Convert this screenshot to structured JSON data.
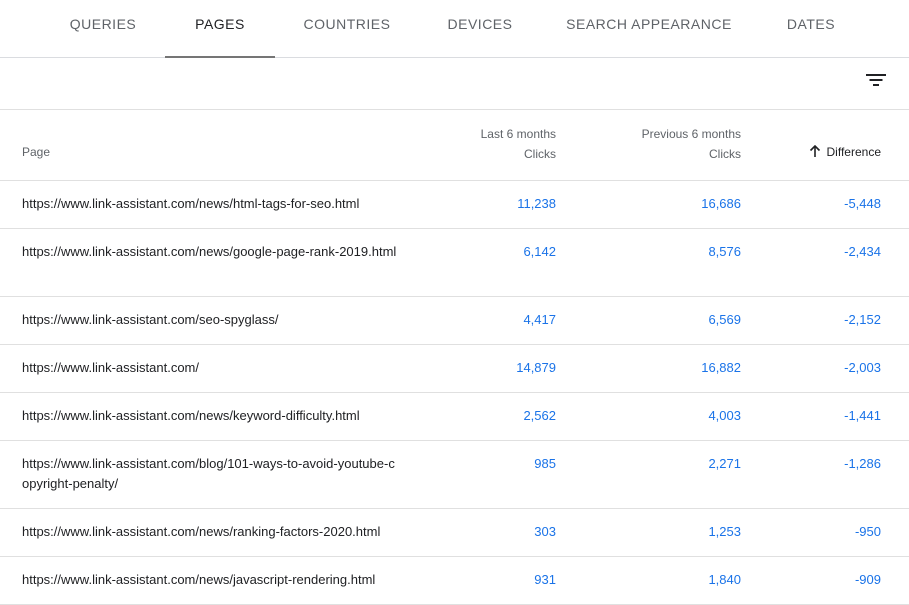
{
  "tabs": [
    {
      "label": "QUERIES",
      "active": false
    },
    {
      "label": "PAGES",
      "active": true
    },
    {
      "label": "COUNTRIES",
      "active": false
    },
    {
      "label": "DEVICES",
      "active": false
    },
    {
      "label": "SEARCH APPEARANCE",
      "active": false
    },
    {
      "label": "DATES",
      "active": false
    }
  ],
  "filter": {
    "icon": "filter-list-icon"
  },
  "table": {
    "headers": {
      "page": "Page",
      "last_period": "Last 6 months",
      "last_metric": "Clicks",
      "prev_period": "Previous 6 months",
      "prev_metric": "Clicks",
      "difference": "Difference",
      "sort_icon": "arrow-upward-icon"
    },
    "rows": [
      {
        "page": "https://www.link-assistant.com/news/html-tags-for-seo.html",
        "last": "11,238",
        "prev": "16,686",
        "diff": "-5,448"
      },
      {
        "page": "https://www.link-assistant.com/news/google-page-rank-2019.html",
        "last": "6,142",
        "prev": "8,576",
        "diff": "-2,434"
      },
      {
        "page": "https://www.link-assistant.com/seo-spyglass/",
        "last": "4,417",
        "prev": "6,569",
        "diff": "-2,152"
      },
      {
        "page": "https://www.link-assistant.com/",
        "last": "14,879",
        "prev": "16,882",
        "diff": "-2,003"
      },
      {
        "page": "https://www.link-assistant.com/news/keyword-difficulty.html",
        "last": "2,562",
        "prev": "4,003",
        "diff": "-1,441"
      },
      {
        "page": "https://www.link-assistant.com/blog/101-ways-to-avoid-youtube-copyright-penalty/",
        "last": "985",
        "prev": "2,271",
        "diff": "-1,286"
      },
      {
        "page": "https://www.link-assistant.com/news/ranking-factors-2020.html",
        "last": "303",
        "prev": "1,253",
        "diff": "-950"
      },
      {
        "page": "https://www.link-assistant.com/news/javascript-rendering.html",
        "last": "931",
        "prev": "1,840",
        "diff": "-909"
      }
    ]
  },
  "colors": {
    "link_blue": "#1a73e8",
    "tab_indicator": "#757575",
    "divider": "#e0e0e0"
  }
}
